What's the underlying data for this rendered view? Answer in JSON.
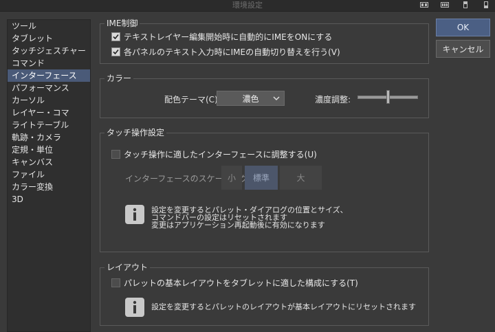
{
  "window": {
    "title": "環境設定"
  },
  "sidebar": {
    "items": [
      {
        "label": "ツール"
      },
      {
        "label": "タブレット"
      },
      {
        "label": "タッチジェスチャー"
      },
      {
        "label": "コマンド"
      },
      {
        "label": "インターフェース",
        "selected": true
      },
      {
        "label": "パフォーマンス"
      },
      {
        "label": "カーソル"
      },
      {
        "label": "レイヤー・コマ"
      },
      {
        "label": "ライトテーブル"
      },
      {
        "label": "軌跡・カメラ"
      },
      {
        "label": "定規・単位"
      },
      {
        "label": "キャンバス"
      },
      {
        "label": "ファイル"
      },
      {
        "label": "カラー変換"
      },
      {
        "label": "3D"
      }
    ]
  },
  "ime": {
    "title": "IME制御",
    "opt1": "テキストレイヤー編集開始時に自動的にIMEをONにする",
    "opt2": "各パネルのテキスト入力時にIMEの自動切り替えを行う(V)"
  },
  "color": {
    "title": "カラー",
    "theme_label": "配色テーマ(C):",
    "theme_value": "濃色",
    "density_label": "濃度調整:",
    "density_level": 0.5
  },
  "touch": {
    "title": "タッチ操作設定",
    "adjust_label": "タッチ操作に適したインターフェースに調整する(U)",
    "scaling_label": "インターフェースのスケーリング:",
    "small": "小",
    "standard": "標準",
    "large": "大",
    "info1": "設定を変更するとパレット・ダイアログの位置とサイズ、",
    "info2": "コマンドバーの設定はリセットされます",
    "info3": "変更はアプリケーション再起動後に有効になります"
  },
  "layout": {
    "title": "レイアウト",
    "option": "パレットの基本レイアウトをタブレットに適した構成にする(T)",
    "info": "設定を変更するとパレットのレイアウトが基本レイアウトにリセットされます"
  },
  "buttons": {
    "ok": "OK",
    "cancel": "キャンセル"
  }
}
